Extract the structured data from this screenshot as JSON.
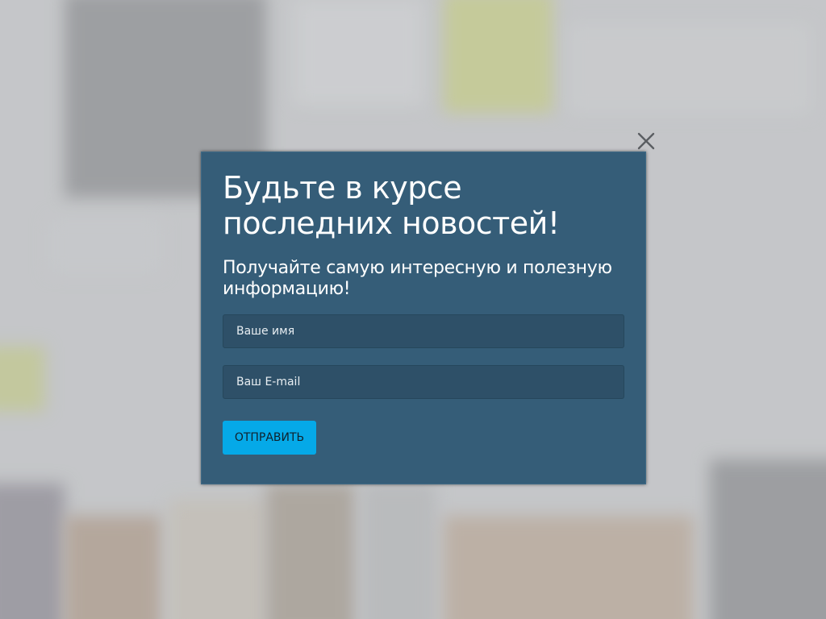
{
  "modal": {
    "title": "Будьте в курсе последних новостей!",
    "subtitle": "Получайте самую интересную и полезную информацию!",
    "name_placeholder": "Ваше имя",
    "email_placeholder": "Ваш E-mail",
    "submit_label": "ОТПРАВИТЬ",
    "close_icon": "close-icon"
  },
  "colors": {
    "modal_background": "#355d78",
    "field_background": "#2e5068",
    "submit_button": "#05a9e8",
    "backdrop": "#c9cacc"
  }
}
